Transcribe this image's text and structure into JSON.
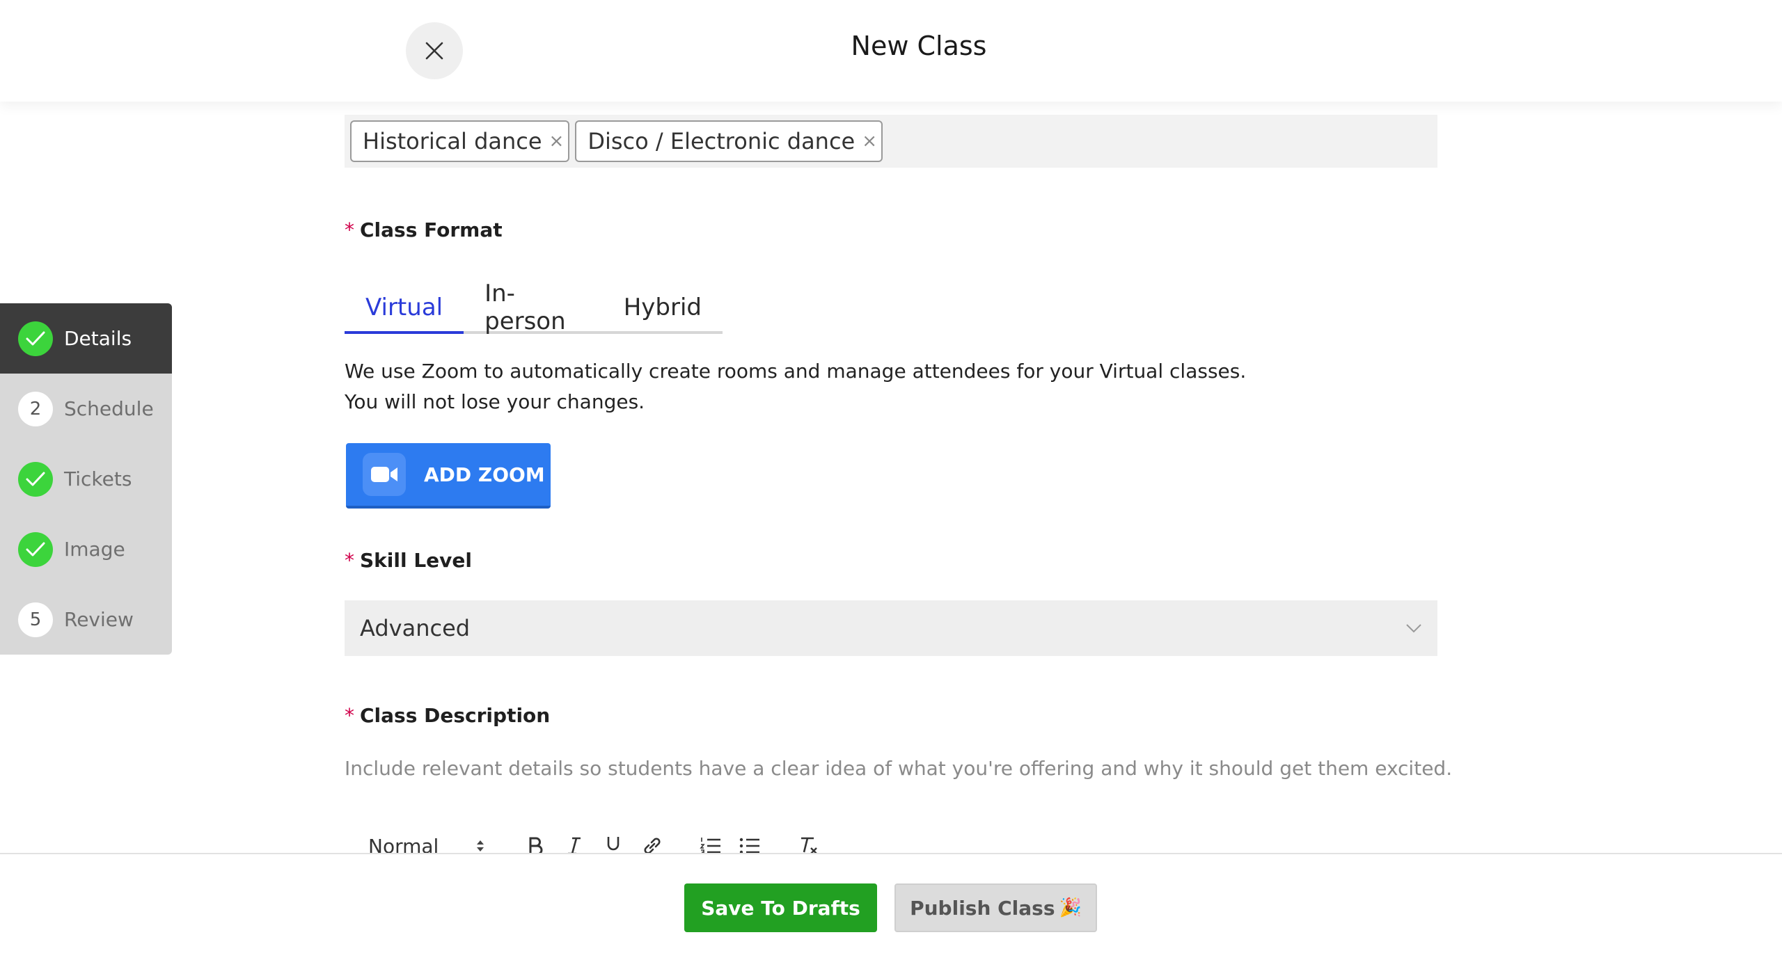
{
  "header": {
    "title": "New Class"
  },
  "steps": [
    {
      "label": "Details",
      "status": "done",
      "active": true
    },
    {
      "label": "Schedule",
      "status": "pending",
      "number": "2"
    },
    {
      "label": "Tickets",
      "status": "done"
    },
    {
      "label": "Image",
      "status": "done"
    },
    {
      "label": "Review",
      "status": "pending",
      "number": "5"
    }
  ],
  "tags": [
    "Historical dance",
    "Disco / Electronic dance"
  ],
  "class_format": {
    "label": "Class Format",
    "tabs": [
      "Virtual",
      "In-person",
      "Hybrid"
    ],
    "selected": "Virtual",
    "description_line1": "We use Zoom to automatically create rooms and manage attendees for your Virtual classes.",
    "description_line2": "You will not lose your changes.",
    "zoom_button": "ADD ZOOM"
  },
  "skill_level": {
    "label": "Skill Level",
    "value": "Advanced"
  },
  "class_description": {
    "label": "Class Description",
    "hint": "Include relevant details so students have a clear idea of what you're offering and why it should get them excited.",
    "toolbar": {
      "format": "Normal"
    }
  },
  "footer": {
    "save_label": "Save To Drafts",
    "publish_label": "Publish Class",
    "publish_emoji": "🎉"
  },
  "colors": {
    "accent": "#2a3bd9",
    "success": "#22a022",
    "check": "#3cd43c",
    "zoom": "#2d7bf0",
    "required": "#d0004a"
  }
}
